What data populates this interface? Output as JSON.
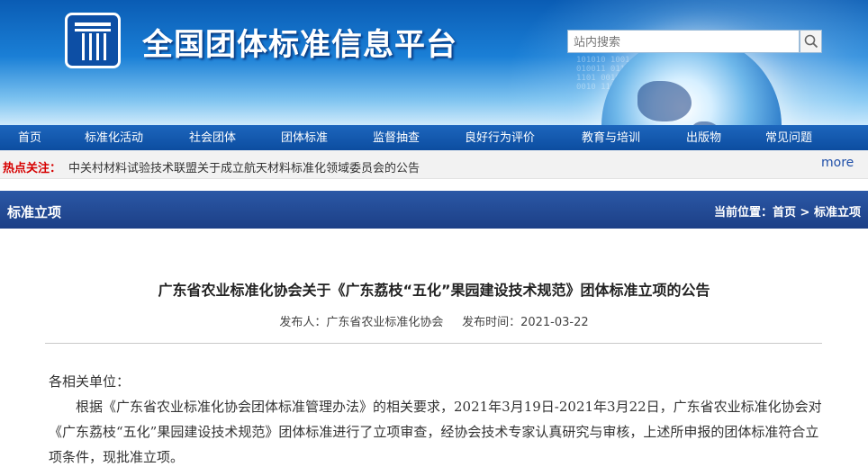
{
  "header": {
    "site_title": "全国团体标准信息平台",
    "search_placeholder": "站内搜索",
    "search_icon": "search-icon",
    "banner_digits": "101010 1001\n010011 0110\n1101 00101\n0010 11010"
  },
  "nav": {
    "items": [
      {
        "label": "首页"
      },
      {
        "label": "标准化活动"
      },
      {
        "label": "社会团体"
      },
      {
        "label": "团体标准"
      },
      {
        "label": "监督抽查"
      },
      {
        "label": "良好行为评价"
      },
      {
        "label": "教育与培训"
      },
      {
        "label": "出版物"
      },
      {
        "label": "常见问题"
      }
    ]
  },
  "hot_news": {
    "label": "热点关注：",
    "text": "中关村材料试验技术联盟关于成立航天材料标准化领域委员会的公告",
    "more": "more"
  },
  "section": {
    "title": "标准立项",
    "breadcrumb_prefix": "当前位置：",
    "breadcrumb_home": "首页",
    "breadcrumb_sep": ">",
    "breadcrumb_current": "标准立项"
  },
  "article": {
    "title": "广东省农业标准化协会关于《广东荔枝“五化”果园建设技术规范》团体标准立项的公告",
    "publisher_label": "发布人：",
    "publisher": "广东省农业标准化协会",
    "date_label": "发布时间：",
    "date": "2021-03-22",
    "salutation": "各相关单位：",
    "paragraph": "根据《广东省农业标准化协会团体标准管理办法》的相关要求，2021年3月19日-2021年3月22日，广东省农业标准化协会对《广东荔枝“五化”果园建设技术规范》团体标准进行了立项审查，经协会技术专家认真研究与审核，上述所申报的团体标准符合立项条件，现批准立项。"
  },
  "colors": {
    "nav_bg": "#0c4da0",
    "section_bg": "#1c3f86",
    "hot_label": "#d60000",
    "more_link": "#1f4fa8"
  }
}
